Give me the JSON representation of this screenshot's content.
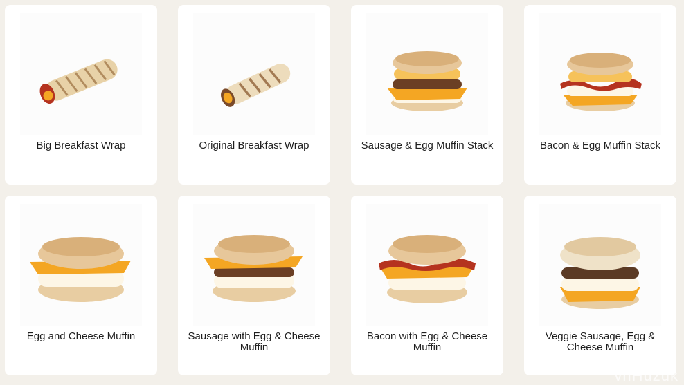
{
  "items": [
    {
      "name": "Big Breakfast Wrap",
      "image": "wrap-big-icon"
    },
    {
      "name": "Original Breakfast Wrap",
      "image": "wrap-original-icon"
    },
    {
      "name": "Sausage & Egg Muffin Stack",
      "image": "sausage-egg-stack-icon"
    },
    {
      "name": "Bacon & Egg Muffin Stack",
      "image": "bacon-egg-stack-icon"
    },
    {
      "name": "Egg and Cheese Muffin",
      "image": "egg-cheese-muffin-icon"
    },
    {
      "name": "Sausage with Egg & Cheese Muffin",
      "image": "sausage-egg-cheese-muffin-icon"
    },
    {
      "name": "Bacon with Egg & Cheese Muffin",
      "image": "bacon-egg-cheese-muffin-icon"
    },
    {
      "name": "Veggie Sausage, Egg & Cheese Muffin",
      "image": "veggie-sausage-egg-cheese-muffin-icon"
    }
  ],
  "watermark": "vnHuzuk",
  "colors": {
    "background": "#f3f0ea",
    "card": "#ffffff",
    "bun": "#e7c79a",
    "cheese": "#f4a623",
    "egg": "#fdf6e6",
    "sausage": "#6b3f24",
    "bacon": "#b5331f"
  }
}
